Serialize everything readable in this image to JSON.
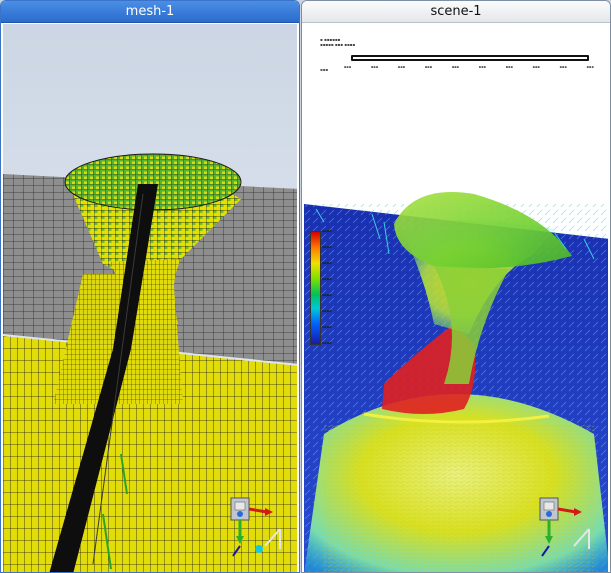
{
  "panels": {
    "left": {
      "tab_label": "mesh-1"
    },
    "right": {
      "tab_label": "scene-1"
    }
  },
  "colors": {
    "active_tab": "#2a6ccc",
    "mesh_yellow": "#e6e000",
    "mesh_green": "#2fa52f",
    "floor_gray": "#8a8a8a",
    "background_sky": "#dfe6ef",
    "volume_blue": "#1838b8",
    "velocity_red": "#e01818"
  },
  "icons": {
    "mesh_orientation": "orientation-triad-icon",
    "scene_orientation": "orientation-triad-icon"
  }
}
